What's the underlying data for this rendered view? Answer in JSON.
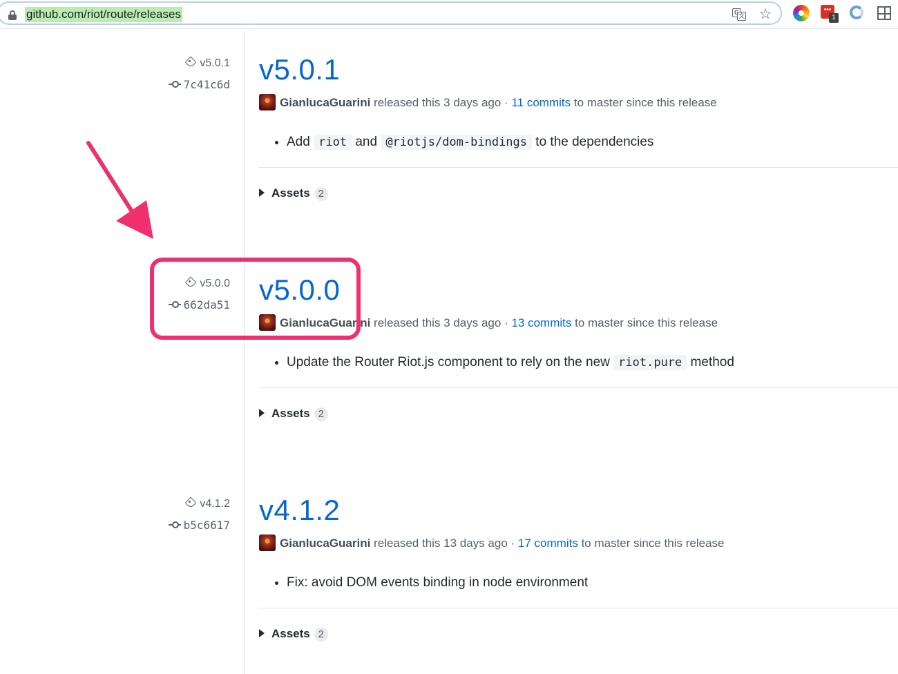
{
  "browser": {
    "url": "github.com/riot/route/releases",
    "extensions": {
      "notification_badge": "1",
      "red_ext_label": "•••"
    }
  },
  "releases": [
    {
      "tag": "v5.0.1",
      "commit": "7c41c6d",
      "title": "v5.0.1",
      "author": "GianlucaGuarini",
      "released_text": "released this 3 days ago ·",
      "commits_link": "11 commits",
      "since_text": "to master since this release",
      "notes": [
        "Add ",
        "riot",
        " and ",
        "@riotjs/dom-bindings",
        " to the dependencies"
      ],
      "assets_label": "Assets",
      "assets_count": "2"
    },
    {
      "tag": "v5.0.0",
      "commit": "662da51",
      "title": "v5.0.0",
      "author": "GianlucaGuarini",
      "released_text": "released this 3 days ago ·",
      "commits_link": "13 commits",
      "since_text": "to master since this release",
      "notes": [
        "Update the Router Riot.js component to rely on the new ",
        "riot.pure",
        " method"
      ],
      "assets_label": "Assets",
      "assets_count": "2"
    },
    {
      "tag": "v4.1.2",
      "commit": "b5c6617",
      "title": "v4.1.2",
      "author": "GianlucaGuarini",
      "released_text": "released this 13 days ago ·",
      "commits_link": "17 commits",
      "since_text": "to master since this release",
      "notes": [
        "Fix: avoid DOM events binding in node environment"
      ],
      "assets_label": "Assets",
      "assets_count": "2"
    }
  ],
  "annotation": {
    "color": "#f0306e"
  }
}
